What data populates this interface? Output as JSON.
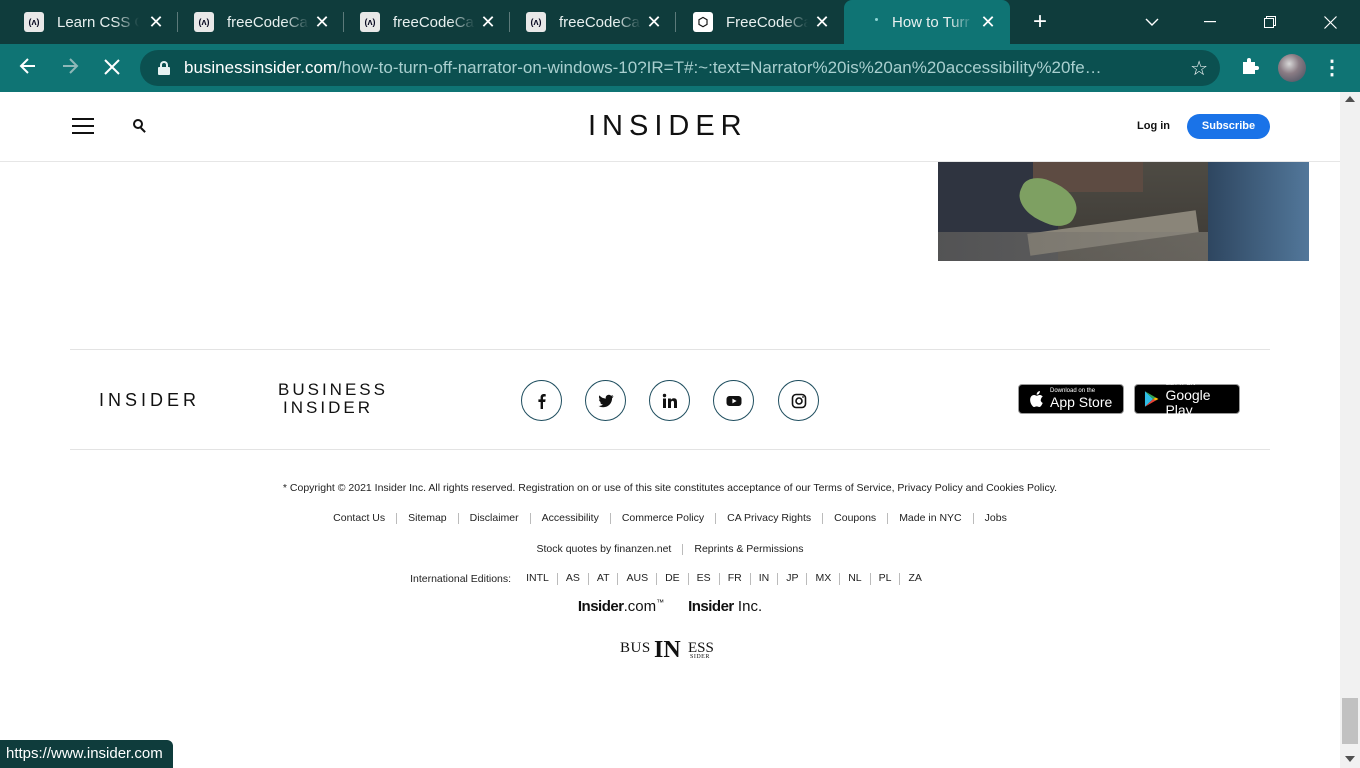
{
  "browser": {
    "tabs": [
      {
        "title": "Learn CSS G",
        "favicon": "fcc-icon"
      },
      {
        "title": "freeCodeCa",
        "favicon": "fcc-icon"
      },
      {
        "title": "freeCodeCa",
        "favicon": "fcc-icon"
      },
      {
        "title": "freeCodeCa",
        "favicon": "fcc-icon"
      },
      {
        "title": "FreeCodeCa",
        "favicon": "codepen-icon"
      },
      {
        "title": "How to Turr",
        "favicon": "loading-icon",
        "active": true
      }
    ],
    "url_host": "businessinsider.com",
    "url_path": "/how-to-turn-off-narrator-on-windows-10?IR=T#:~:text=Narrator%20is%20an%20accessibility%20fe…",
    "status_url": "https://www.insider.com"
  },
  "header": {
    "logo": "INSIDER",
    "login": "Log in",
    "subscribe": "Subscribe"
  },
  "footer": {
    "brand_insider": "INSIDER",
    "brand_bi_line1": "BUSINESS",
    "brand_bi_line2": "INSIDER",
    "social": [
      "facebook-icon",
      "twitter-icon",
      "linkedin-icon",
      "youtube-icon",
      "instagram-icon"
    ],
    "appstore_small": "Download on the",
    "appstore_big": "App Store",
    "googleplay_small": "GET IT ON",
    "googleplay_big": "Google Play",
    "copyright": "* Copyright © 2021 Insider Inc. All rights reserved. Registration on or use of this site constitutes acceptance of our Terms of Service,  Privacy Policy  and  Cookies Policy.",
    "links": [
      "Contact Us",
      "Sitemap",
      "Disclaimer",
      "Accessibility",
      "Commerce Policy",
      "CA Privacy Rights",
      "Coupons",
      "Made in NYC",
      "Jobs"
    ],
    "links2": [
      "Stock quotes by finanzen.net",
      "Reprints & Permissions"
    ],
    "editions_label": "International Editions:",
    "editions": [
      "INTL",
      "AS",
      "AT",
      "AUS",
      "DE",
      "ES",
      "FR",
      "IN",
      "JP",
      "MX",
      "NL",
      "PL",
      "ZA"
    ],
    "insider_com_bold": "Insider",
    "insider_com_rest": ".com",
    "insider_com_tm": "™",
    "insider_inc_bold": "Insider",
    "insider_inc_rest": " Inc.",
    "bi_mark_a": "BUS",
    "bi_mark_b": "IN",
    "bi_mark_c": "ESS",
    "bi_mark_d": "SIDER"
  }
}
